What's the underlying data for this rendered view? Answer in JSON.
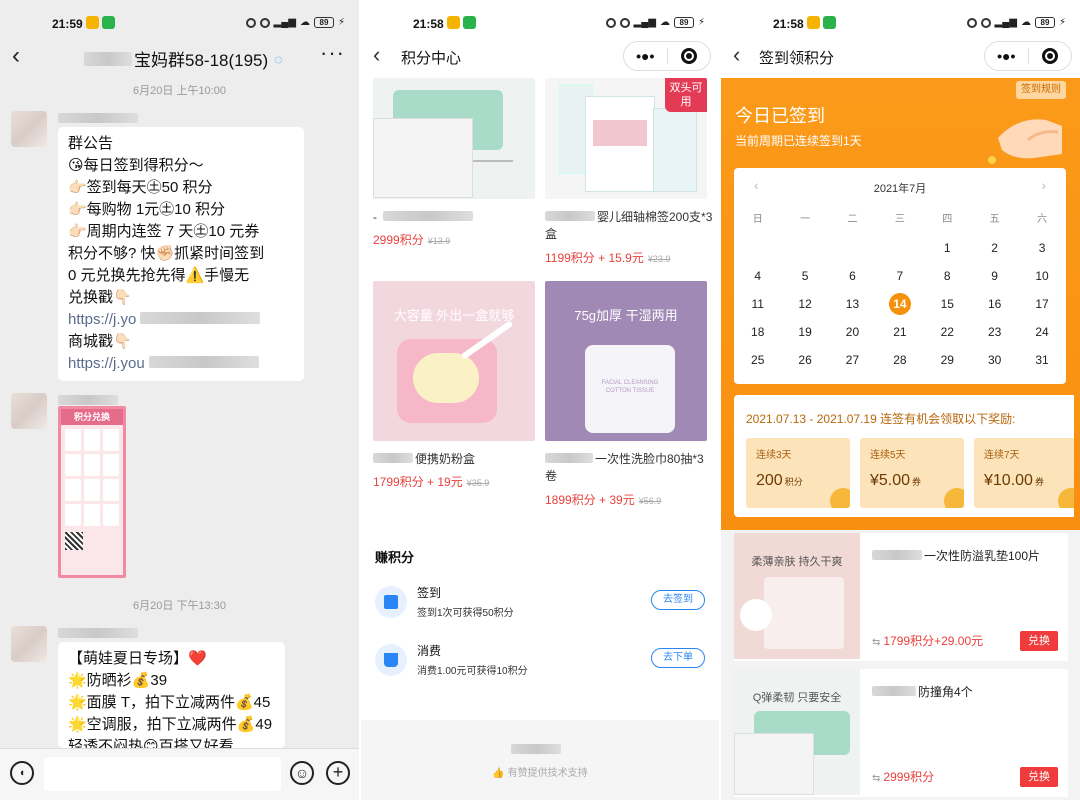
{
  "colors": {
    "orange": "#f98f10",
    "price_red": "#e8413d",
    "blue": "#2a86f5",
    "exchange_red": "#ef3b3b"
  },
  "panel1": {
    "status_time": "21:59",
    "group_title": "宝妈群58-18(195)",
    "more": "···",
    "date1": "6月20日 上午10:00",
    "announcement": [
      "群公告",
      "😘每日签到得积分～",
      "👉🏻签到每天㊏50 积分",
      "👉🏻每购物 1元㊏10 积分",
      "👉🏻周期内连签 7 天㊏10 元券",
      "积分不够? 快✊🏻抓紧时间签到",
      "0 元兑换先抢先得⚠️手慢无",
      "兑换戳👇🏻"
    ],
    "link1": "https://j.yo",
    "mall_label": "商城戳👇🏻",
    "link2": "https://j.you",
    "poster_header": "积分兑换",
    "date2": "6月20日 下午13:30",
    "promo": [
      "【萌娃夏日专场】❤️",
      "🌟防晒衫💰39",
      "🌟面膜 T，拍下立减两件💰45",
      "🌟空调服，拍下立减两件💰49",
      "轻透不闷热😊百搭又好看"
    ]
  },
  "panel2": {
    "status_time": "21:58",
    "title": "积分中心",
    "capsule_dots": "•●•",
    "badge": "双头可用",
    "products": [
      {
        "name": "-",
        "price": "2999积分",
        "old": "¥13.9"
      },
      {
        "name": "婴儿细轴棉签200支*3盒",
        "price": "1199积分 + 15.9元",
        "old": "¥23.9"
      },
      {
        "name": "便携奶粉盒",
        "price": "1799积分 + 19元",
        "old": "¥35.9",
        "img_text": "大容量 外出一盒就够"
      },
      {
        "name": "一次性洗脸巾80抽*3卷",
        "price": "1899积分 + 39元",
        "old": "¥56.9",
        "img_text": "75g加厚  干湿两用",
        "tissue_text": "FACIAL CLEANSING COTTON TISSUE"
      }
    ],
    "earn_title": "赚积分",
    "tasks": [
      {
        "title": "签到",
        "desc": "签到1次可获得50积分",
        "button": "去签到"
      },
      {
        "title": "消费",
        "desc": "消费1.00元可获得10积分",
        "button": "去下单"
      }
    ],
    "footer": "有赞提供技术支持"
  },
  "panel3": {
    "status_time": "21:58",
    "title": "签到领积分",
    "rule": "签到规则",
    "signed_title": "今日已签到",
    "signed_sub": "当前周期已连续签到1天",
    "calendar": {
      "month": "2021年7月",
      "weekdays": [
        "日",
        "一",
        "二",
        "三",
        "四",
        "五",
        "六"
      ],
      "weeks": [
        [
          "",
          "",
          "",
          "",
          "1",
          "2",
          "3"
        ],
        [
          "4",
          "5",
          "6",
          "7",
          "8",
          "9",
          "10"
        ],
        [
          "11",
          "12",
          "13",
          "14",
          "15",
          "16",
          "17"
        ],
        [
          "18",
          "19",
          "20",
          "21",
          "22",
          "23",
          "24"
        ],
        [
          "25",
          "26",
          "27",
          "28",
          "29",
          "30",
          "31"
        ]
      ],
      "today": "14"
    },
    "reward_title": "2021.07.13 - 2021.07.19 连签有机会领取以下奖励:",
    "rewards": [
      {
        "label": "连续3天",
        "value": "200",
        "unit": "积分"
      },
      {
        "label": "连续5天",
        "value": "¥5.00",
        "unit": "券"
      },
      {
        "label": "连续7天",
        "value": "¥10.00",
        "unit": "券"
      }
    ],
    "items": [
      {
        "name": "一次性防溢乳垫100片",
        "price": "1799积分+29.00元",
        "button": "兑换",
        "img_text": "柔薄亲肤 持久干爽"
      },
      {
        "name": "防撞角4个",
        "price": "2999积分",
        "button": "兑换",
        "img_text": "Q弹柔韧 只要安全"
      }
    ]
  }
}
